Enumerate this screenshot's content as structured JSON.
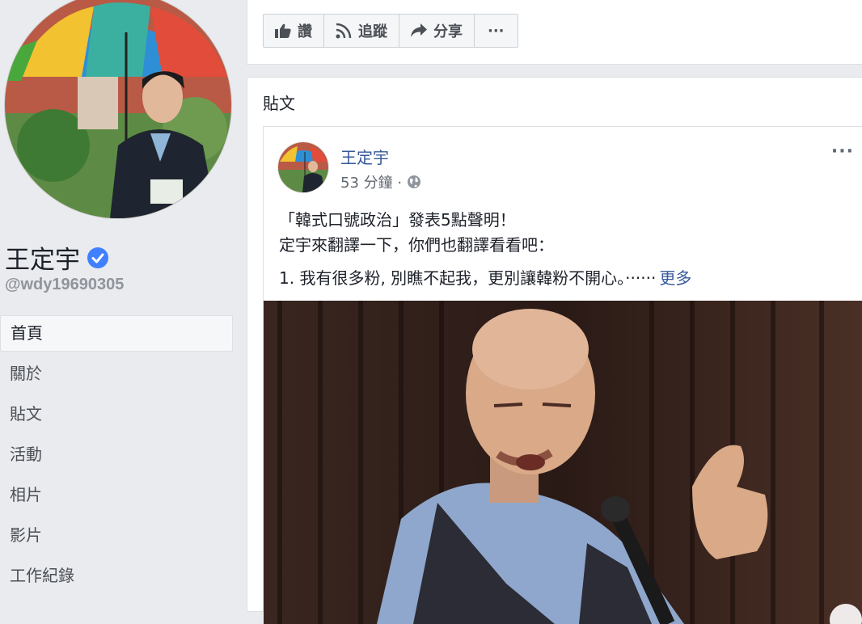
{
  "profile": {
    "name": "王定宇",
    "handle": "@wdy19690305"
  },
  "nav": {
    "items": [
      {
        "label": "首頁",
        "active": true
      },
      {
        "label": "關於"
      },
      {
        "label": "貼文"
      },
      {
        "label": "活動"
      },
      {
        "label": "相片"
      },
      {
        "label": "影片"
      },
      {
        "label": "工作紀錄"
      }
    ]
  },
  "actions": {
    "like": "讚",
    "follow": "追蹤",
    "share": "分享",
    "more": "···"
  },
  "posts": {
    "section_title": "貼文",
    "post": {
      "author": "王定宇",
      "time": "53 分鐘 ·",
      "menu": "···",
      "lines": [
        "「韓式口號政治」發表5點聲明！",
        "定宇來翻譯一下，你們也翻譯看看吧：",
        "1. 我有很多粉, 別瞧不起我，更別讓韓粉不開心。······"
      ],
      "see_more": "更多"
    }
  },
  "colors": {
    "link": "#365899",
    "background": "#e9ebee",
    "verified": "#4080ff"
  },
  "icons": {
    "like": "thumbs-up-icon",
    "follow": "rss-icon",
    "share": "share-arrow-icon",
    "verified": "verified-badge-icon",
    "privacy": "globe-icon"
  }
}
